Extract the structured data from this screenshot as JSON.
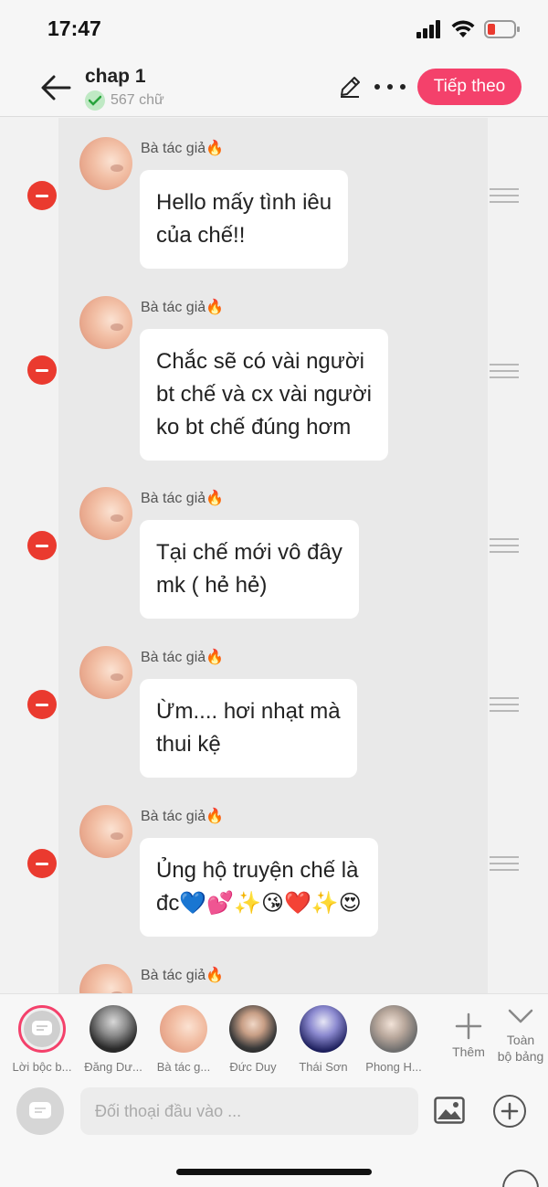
{
  "status_bar": {
    "time": "17:47"
  },
  "header": {
    "title": "chap 1",
    "word_count": "567 chữ",
    "next_label": "Tiếp theo"
  },
  "messages": [
    {
      "author": "Bà tác giả🔥",
      "text": "Hello mấy tình iêu\ncủa chế!!"
    },
    {
      "author": "Bà tác giả🔥",
      "text": "Chắc sẽ có vài người\nbt chế và cx vài người\nko bt chế đúng hơm"
    },
    {
      "author": "Bà tác giả🔥",
      "text": "Tại chế mới vô đây\nmk ( hẻ hẻ)"
    },
    {
      "author": "Bà tác giả🔥",
      "text": "Ừm.... hơi nhạt mà\nthui kệ"
    },
    {
      "author": "Bà tác giả🔥",
      "text": "Ủng hộ truyện chế là\nđc💙💕✨😘❤️✨😍"
    },
    {
      "author": "Bà tác giả🔥",
      "text": ""
    }
  ],
  "characters": [
    {
      "name": "Lời bộc b..."
    },
    {
      "name": "Đăng Dư..."
    },
    {
      "name": "Bà tác g..."
    },
    {
      "name": "Đức Duy"
    },
    {
      "name": "Thái Sơn"
    },
    {
      "name": "Phong H..."
    }
  ],
  "character_bar": {
    "add_label": "Thêm",
    "collapse_label": "Toàn\nbộ bảng"
  },
  "input": {
    "placeholder": "Đối thoại đầu vào ..."
  },
  "colors": {
    "accent": "#f4416b",
    "remove": "#ea3a2f"
  }
}
